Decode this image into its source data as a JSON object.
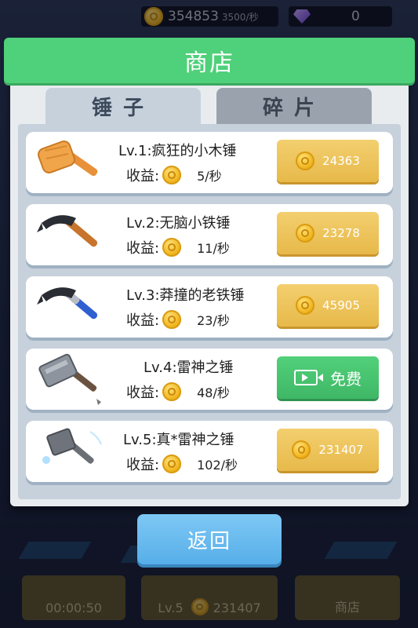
{
  "top_bar": {
    "coins": "354853",
    "coin_rate": "3500/秒",
    "gems": "0"
  },
  "background": {
    "timer": "00:00:50",
    "level_label": "Lv.5",
    "level_coins": "231407",
    "shop_label": "商店"
  },
  "modal": {
    "title": "商店",
    "tabs": [
      {
        "label": "锤子",
        "active": true
      },
      {
        "label": "碎片",
        "active": false
      }
    ],
    "income_label": "收益:",
    "items": [
      {
        "title": "Lv.1:疯狂的小木锤",
        "income": "5/秒",
        "price": "24363",
        "icon": "wooden-mallet-icon"
      },
      {
        "title": "Lv.2:无脑小铁锤",
        "income": "11/秒",
        "price": "23278",
        "icon": "claw-hammer-icon"
      },
      {
        "title": "Lv.3:莽撞的老铁锤",
        "income": "23/秒",
        "price": "45905",
        "icon": "claw-hammer-blue-icon"
      },
      {
        "title": "Lv.4:雷神之锤",
        "income": "48/秒",
        "price": "免费",
        "icon": "war-hammer-icon"
      },
      {
        "title": "Lv.5:真*雷神之锤",
        "income": "102/秒",
        "price": "231407",
        "icon": "thor-hammer-icon"
      }
    ],
    "return_label": "返回"
  },
  "colors": {
    "header_green": "#4fd07a",
    "gold_button": "#e7b94a",
    "free_button": "#3fb866",
    "return_button": "#56aee8"
  }
}
